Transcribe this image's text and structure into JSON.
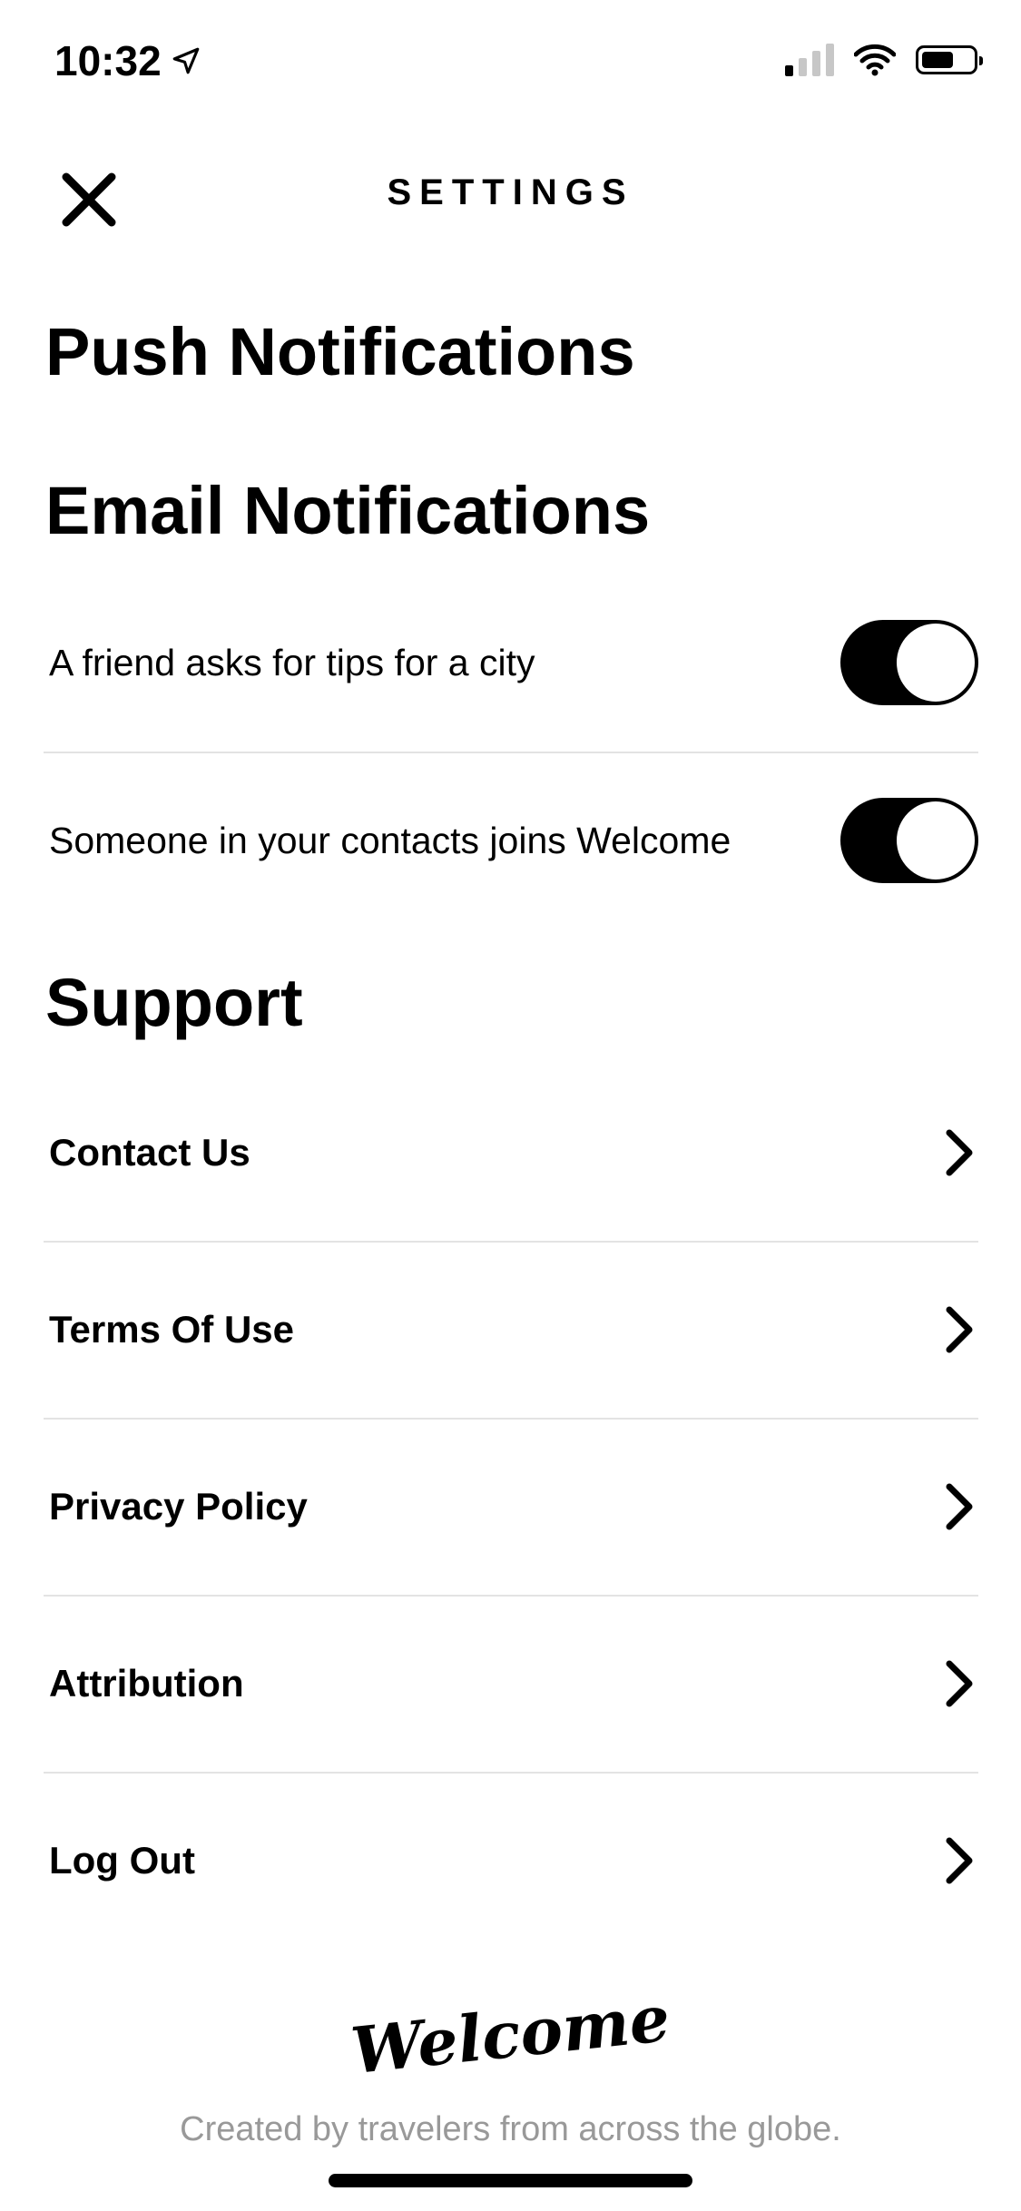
{
  "status_bar": {
    "time": "10:32",
    "location_icon": "location-arrow-icon",
    "signal_icon": "cellular-signal-icon",
    "wifi_icon": "wifi-icon",
    "battery_icon": "battery-icon",
    "signal_bars_active": 1,
    "signal_bars_total": 4
  },
  "header": {
    "title": "SETTINGS",
    "close_icon": "close-icon"
  },
  "sections": {
    "push": {
      "heading": "Push Notifications"
    },
    "email": {
      "heading": "Email Notifications",
      "toggles": [
        {
          "label": "A friend asks for tips for a city",
          "on": true
        },
        {
          "label": "Someone in your contacts joins Welcome",
          "on": true
        }
      ]
    },
    "support": {
      "heading": "Support",
      "items": [
        {
          "label": "Contact Us"
        },
        {
          "label": "Terms Of Use"
        },
        {
          "label": "Privacy Policy"
        },
        {
          "label": "Attribution"
        },
        {
          "label": "Log Out"
        }
      ]
    }
  },
  "footer": {
    "logo": "Welcome",
    "tagline": "Created by travelers from across the globe."
  },
  "colors": {
    "text": "#000000",
    "toggle_on": "#000000",
    "divider": "#e3e3e3",
    "tagline": "#999999",
    "background": "#ffffff"
  }
}
